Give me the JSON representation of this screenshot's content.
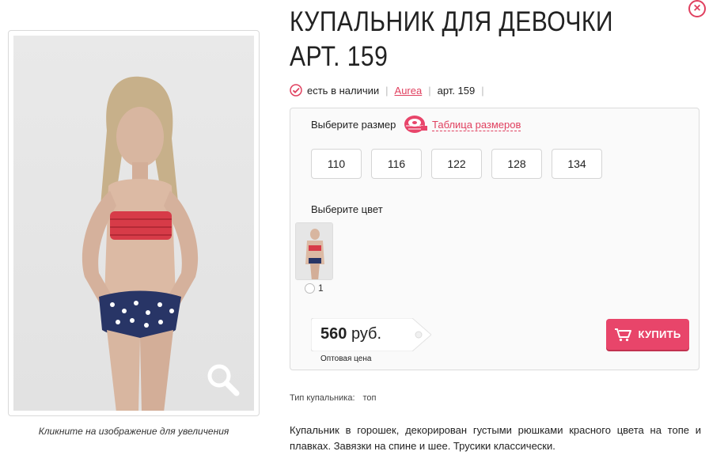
{
  "product": {
    "title": "КУПАЛЬНИК ДЛЯ ДЕВОЧКИ АРТ. 159",
    "availability": "есть в наличии",
    "brand": "Aurea",
    "article": "арт. 159"
  },
  "image": {
    "caption": "Кликните на изображение для увеличения",
    "zoom_icon": "magnifier-icon"
  },
  "size": {
    "label": "Выберите размер",
    "table_link": "Таблица размеров",
    "options": [
      "110",
      "116",
      "122",
      "128",
      "134"
    ]
  },
  "color": {
    "label": "Выберите цвет",
    "options": [
      {
        "value": "1"
      }
    ]
  },
  "price": {
    "amount": "560",
    "currency": "руб.",
    "note": "Оптовая цена"
  },
  "buy": {
    "label": "КУПИТЬ",
    "icon": "cart-icon"
  },
  "attributes": {
    "swim_type_label": "Тип купальника:",
    "swim_type_value": "топ"
  },
  "description": "Купальник в горошек, декорирован густыми рюшками красного цвета на топе и плавках. Завязки на спине и шее. Трусики классически.",
  "colors": {
    "accent": "#e0405f",
    "buy_button": "#e8456a"
  }
}
